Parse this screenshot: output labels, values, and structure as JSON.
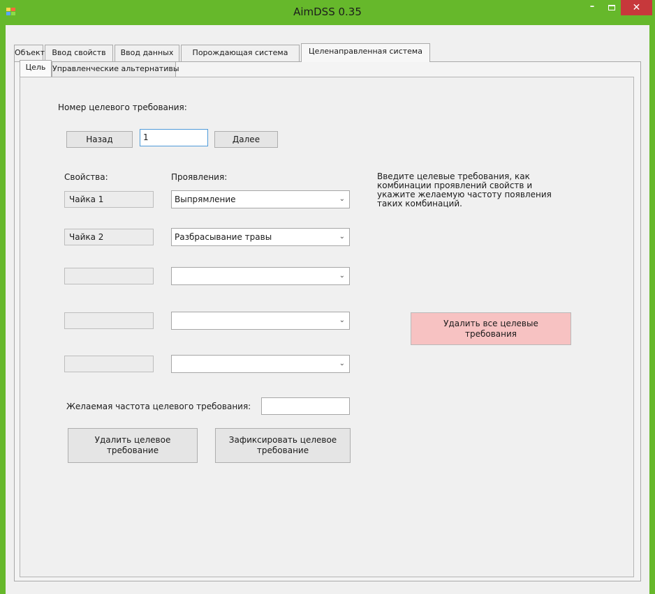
{
  "window": {
    "title": "AimDSS 0.35",
    "controls": {
      "minimize": "–",
      "close": "✕"
    }
  },
  "outer_tabs": [
    {
      "label": "Объект"
    },
    {
      "label": "Ввод свойств"
    },
    {
      "label": "Ввод данных"
    },
    {
      "label": "Порождающая система"
    },
    {
      "label": "Целенаправленная система"
    }
  ],
  "inner_tabs": [
    {
      "label": "Цель"
    },
    {
      "label": "Управленческие альтернативы"
    }
  ],
  "goal": {
    "number_label": "Номер целевого требования:",
    "back_label": "Назад",
    "number_value": "1",
    "next_label": "Далее",
    "properties_header": "Свойства:",
    "manifestations_header": "Проявления:",
    "rows": [
      {
        "property": "Чайка 1",
        "manifestation": "Выпрямление"
      },
      {
        "property": "Чайка 2",
        "manifestation": "Разбрасывание травы"
      },
      {
        "property": "",
        "manifestation": ""
      },
      {
        "property": "",
        "manifestation": ""
      },
      {
        "property": "",
        "manifestation": ""
      }
    ],
    "info_lines": [
      "Введите целевые требования, как",
      "комбинации проявлений свойств и",
      "укажите желаемую частоту появления",
      "таких комбинаций."
    ],
    "delete_all_line1": "Удалить все целевые",
    "delete_all_line2": "требования",
    "frequency_label": "Желаемая частота целевого требования:",
    "frequency_value": "",
    "delete_line1": "Удалить целевое",
    "delete_line2": "требование",
    "fix_line1": "Зафиксировать целевое",
    "fix_line2": "требование"
  },
  "icons": {
    "dropdown": "chevron-down-icon",
    "app": "app-icon"
  },
  "colors": {
    "titlebar": "#66b82b",
    "close": "#c7383b",
    "delete_all_bg": "#f7c2c2"
  }
}
